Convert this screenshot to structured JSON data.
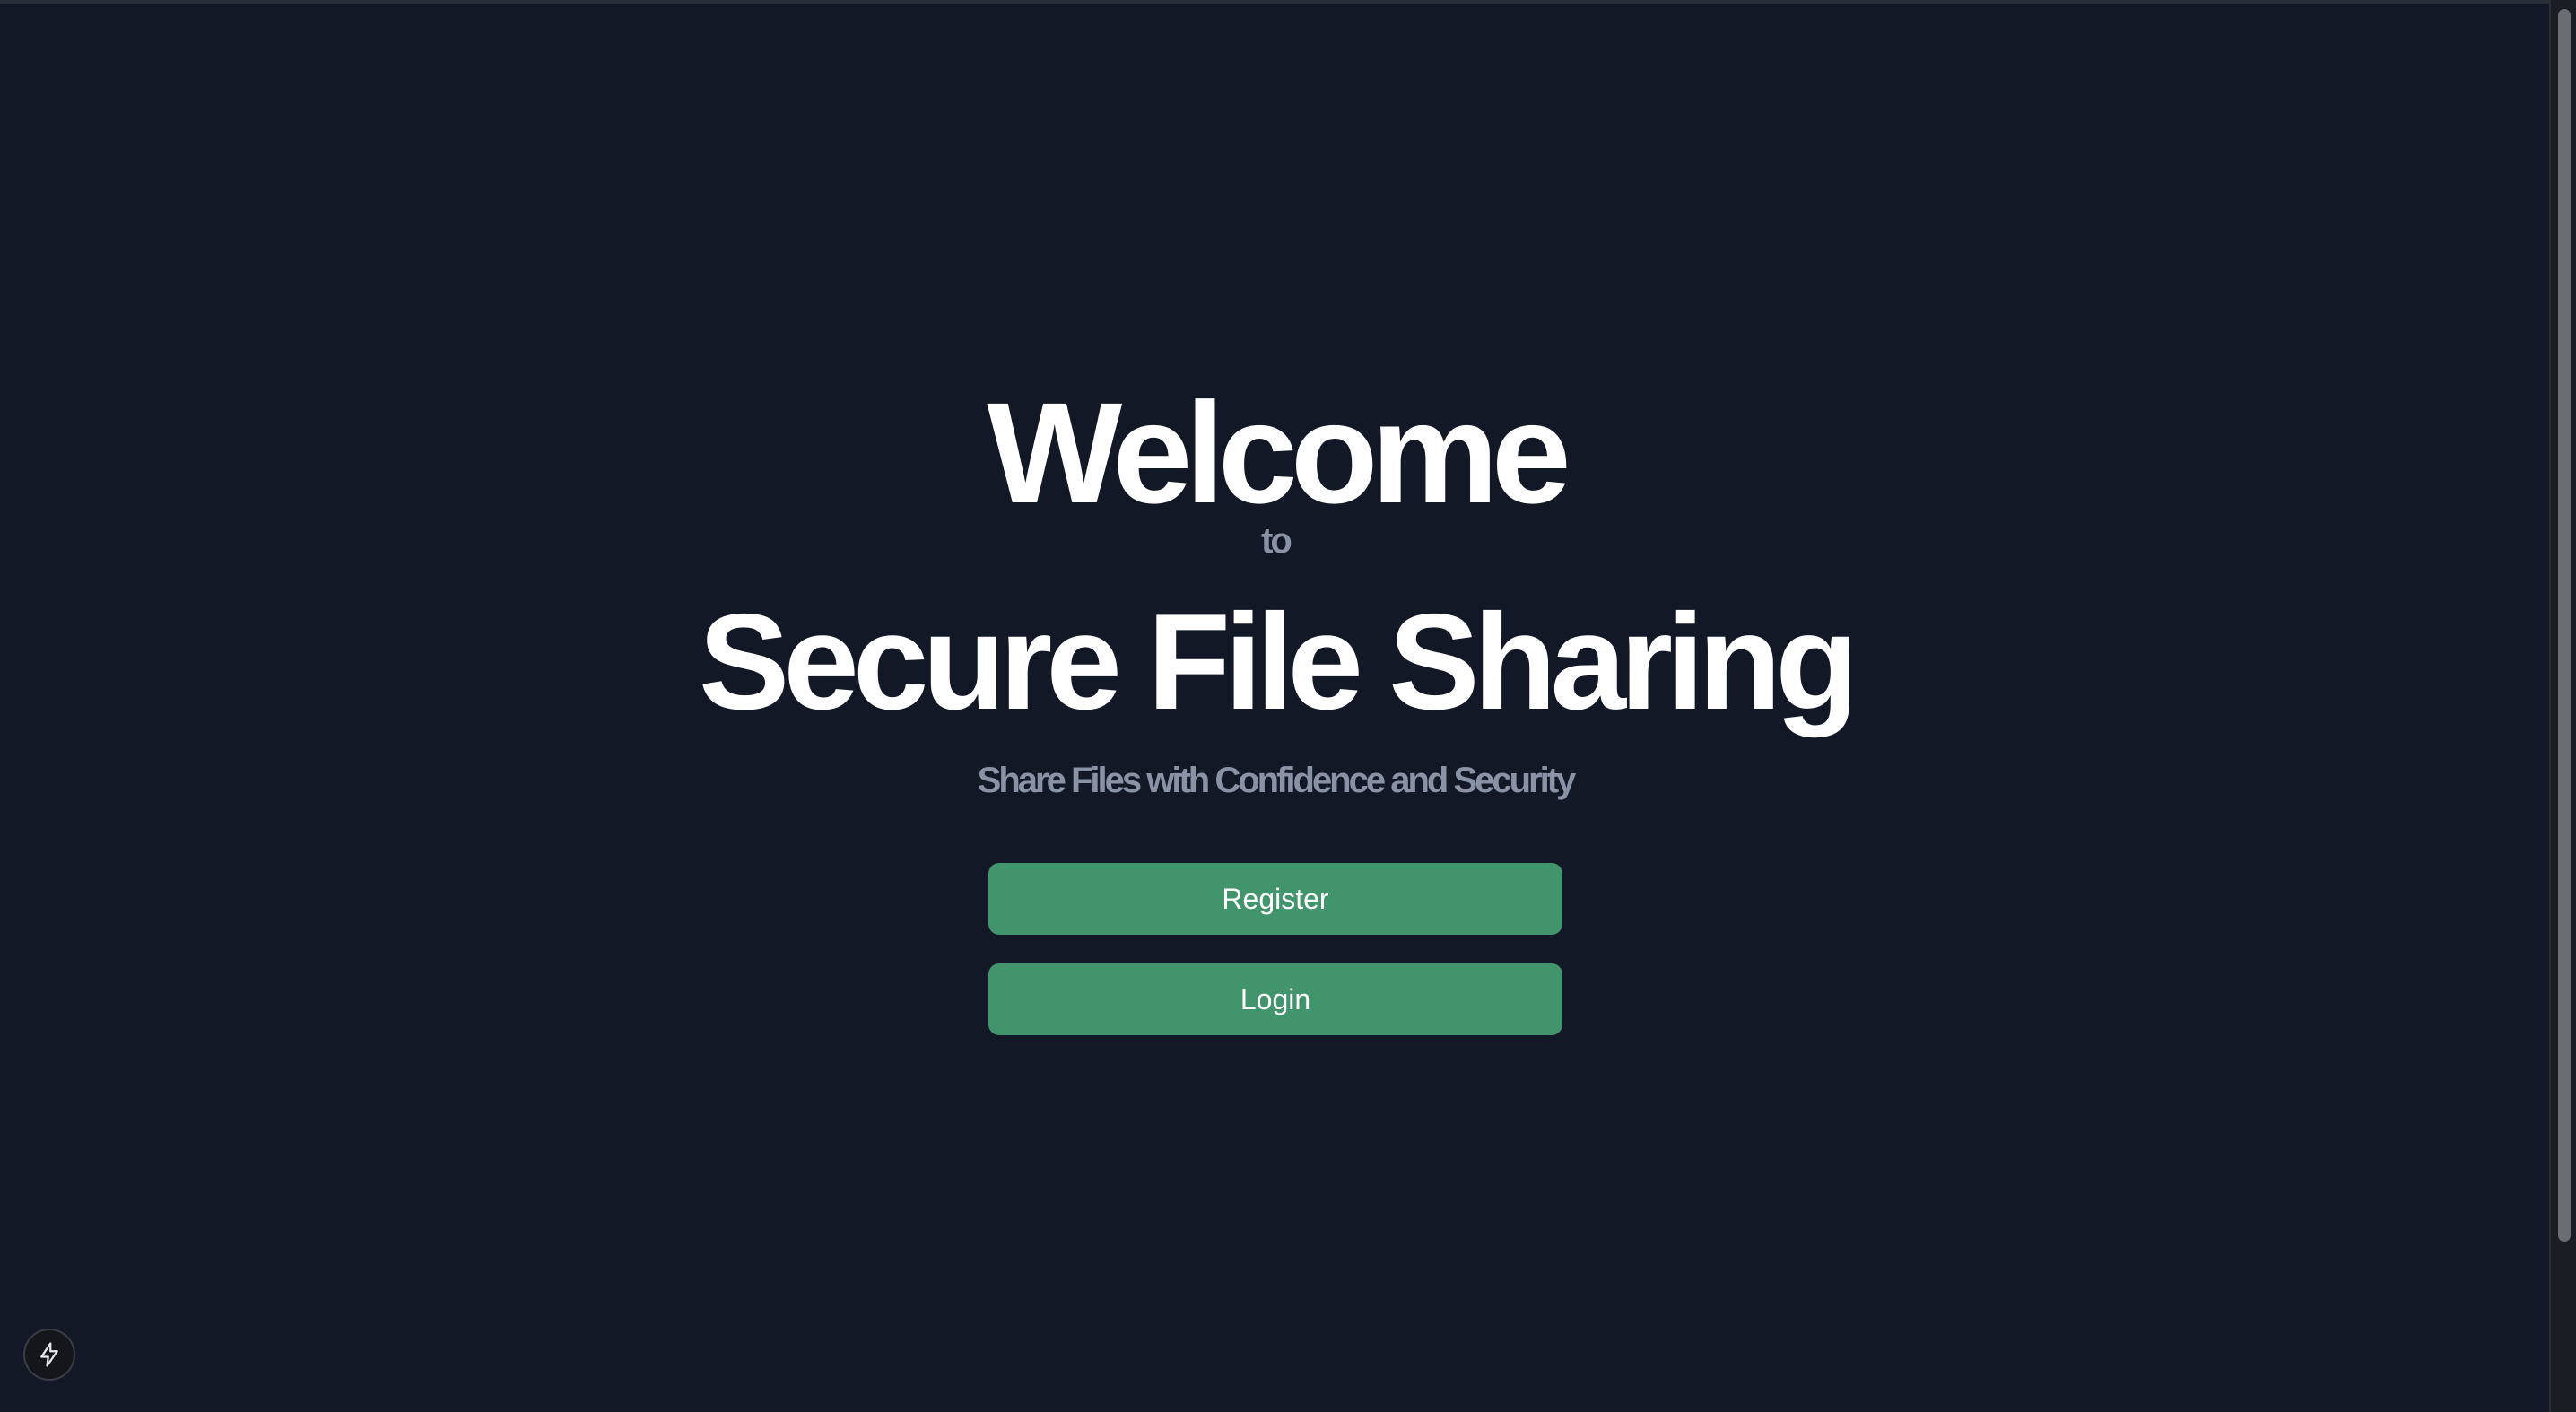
{
  "hero": {
    "welcome": "Welcome",
    "to": "to",
    "title": "Secure File Sharing",
    "tagline": "Share Files with Confidence and Security"
  },
  "actions": {
    "register_label": "Register",
    "login_label": "Login"
  },
  "corner_badge": {
    "icon": "lightning-bolt-icon"
  },
  "colors": {
    "background": "#121826",
    "heading": "#ffffff",
    "muted_text": "#8a92a6",
    "button": "#42946d"
  }
}
